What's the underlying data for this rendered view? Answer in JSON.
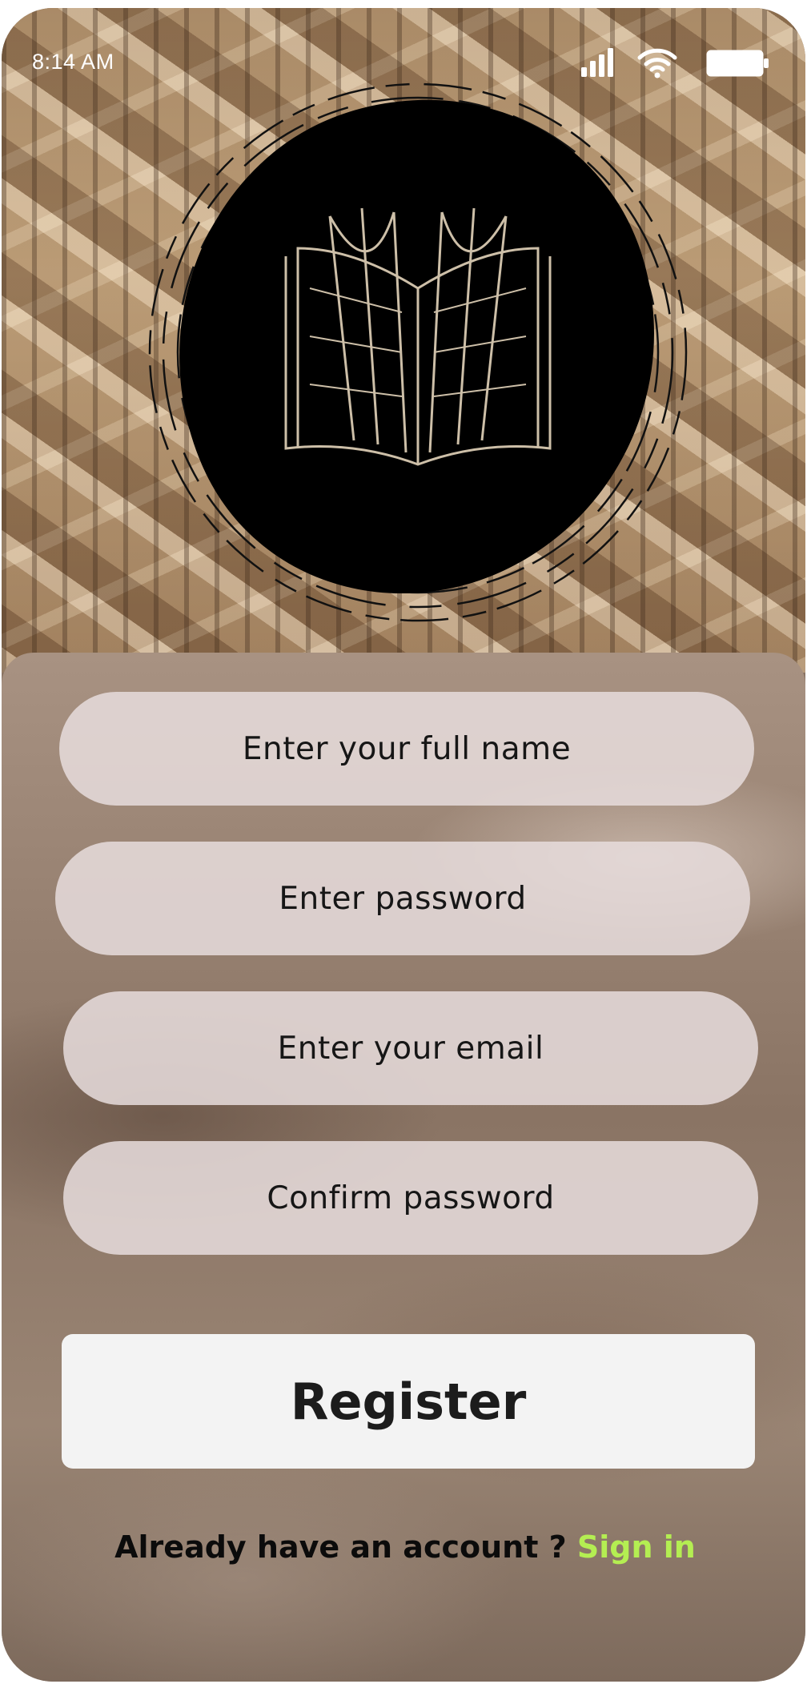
{
  "status_bar": {
    "time": "8:14 AM",
    "icons": [
      "signal-icon",
      "wifi-icon",
      "battery-icon"
    ]
  },
  "logo": {
    "icon": "open-book-icon"
  },
  "form": {
    "full_name_placeholder": "Enter your full name",
    "password_placeholder": "Enter password",
    "email_placeholder": "Enter your email",
    "confirm_password_placeholder": "Confirm password"
  },
  "register_button": {
    "label": "Register"
  },
  "footer": {
    "prompt": "Already have an account ? ",
    "sign_in_link": "Sign in"
  },
  "colors": {
    "link": "#b4ee52",
    "button_bg": "#f3f3f3",
    "field_bg": "#e6dcdc"
  }
}
